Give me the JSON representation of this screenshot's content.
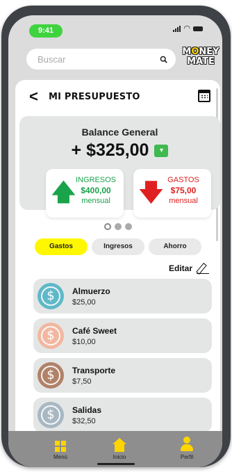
{
  "status_bar": {
    "time": "9:41"
  },
  "search": {
    "placeholder": "Buscar"
  },
  "logo": {
    "line1_a": "M",
    "line1_o": "O",
    "line1_b": "NEY",
    "line2": "MATE"
  },
  "header": {
    "title": "MI PRESUPUESTO"
  },
  "balance": {
    "title": "Balance General",
    "amount": "+ $325,00"
  },
  "summary": {
    "income": {
      "label": "INGRESOS",
      "amount": "$400,00",
      "period": "mensual"
    },
    "expense": {
      "label": "GASTOS",
      "amount": "$75,00",
      "period": "mensual"
    }
  },
  "tabs": [
    {
      "label": "Gastos"
    },
    {
      "label": "Ingresos"
    },
    {
      "label": "Ahorro"
    }
  ],
  "edit": {
    "label": "Editar"
  },
  "expenses": [
    {
      "name": "Almuerzo",
      "amount": "$25,00",
      "color": "#5fb8c8"
    },
    {
      "name": "Café Sweet",
      "amount": "$10,00",
      "color": "#f2b7a0"
    },
    {
      "name": "Transporte",
      "amount": "$7,50",
      "color": "#b08268"
    },
    {
      "name": "Salidas",
      "amount": "$32,50",
      "color": "#a8b8c2"
    }
  ],
  "nav": [
    {
      "label": "Menú",
      "icon": "grid-icon"
    },
    {
      "label": "Inicio",
      "icon": "home-icon"
    },
    {
      "label": "Perfil",
      "icon": "person-icon"
    }
  ],
  "colors": {
    "accent_yellow": "#fff700",
    "income_green": "#19a34a",
    "expense_red": "#e02020",
    "status_green": "#3fd33f"
  }
}
